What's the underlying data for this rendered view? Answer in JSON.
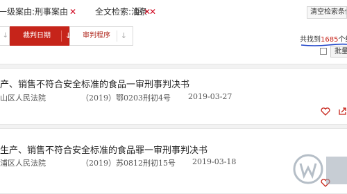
{
  "filters": {
    "tags": [
      "一级案由:刑事案由",
      "全文检索:油条",
      "铝"
    ],
    "clear_label": "清空检索条件"
  },
  "sort": {
    "buttons": [
      {
        "label": "裁判日期",
        "active": true
      },
      {
        "label": "审判程序",
        "active": false
      }
    ],
    "arrow_glyph": "↓"
  },
  "results": {
    "count_prefix": "共找到",
    "count": "1685",
    "count_suffix": "个结果",
    "batch_label": "批量下载"
  },
  "cards": [
    {
      "title": "产、销售不符合安全标准的食品一审刑事判决书",
      "court": "山区人民法院",
      "case_no": "（2019）鄂0203刑初4号",
      "date": "2019-03-27"
    },
    {
      "title": "生产、销售不符合安全标准的食品罪一审刑事判决书",
      "court": "浦区人民法院",
      "case_no": "（2019）苏0812刑初15号",
      "date": "2019-03-18"
    }
  ],
  "icons": [
    "close-icon",
    "arrow-down-icon",
    "heart-icon",
    "share-icon",
    "checkbox-icon"
  ],
  "colors": {
    "accent": "#c6241a",
    "remove_x": "#d0021b",
    "underline": "#1f44c8"
  }
}
